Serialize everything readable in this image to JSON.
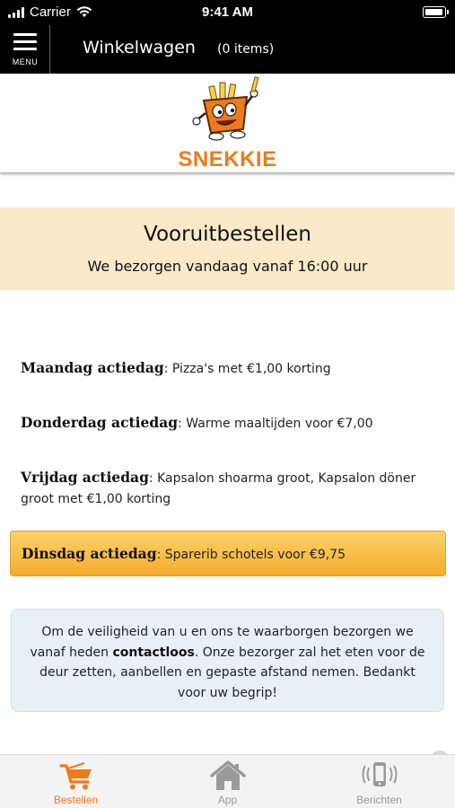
{
  "status_bar": {
    "carrier": "Carrier",
    "time": "9:41 AM",
    "wifi_icon": "wifi-icon",
    "battery_icon": "battery-icon",
    "signal_icon": "signal-icon"
  },
  "header": {
    "menu_label": "MENU",
    "title": "Winkelwagen",
    "item_count": "(0 items)"
  },
  "logo": {
    "brand_text": "SNEKKIE",
    "brand_color": "#f07a1a"
  },
  "banner": {
    "title": "Vooruitbestellen",
    "subtitle": "We bezorgen vandaag vanaf 16:00 uur",
    "background": "#fde9c9"
  },
  "promotions": [
    {
      "day": "Maandag actiedag",
      "text": ": Pizza's met €1,00 korting"
    },
    {
      "day": "Donderdag actiedag",
      "text": ": Warme maaltijden voor €7,00"
    },
    {
      "day": "Vrijdag actiedag",
      "text": ": Kapsalon shoarma groot, Kapsalon döner groot met €1,00 korting"
    }
  ],
  "highlight_promo": {
    "day": "Dinsdag actiedag",
    "text": ": Sparerib schotels voor €9,75"
  },
  "notice": {
    "part1": "Om de veiligheid van u en ons te waarborgen bezorgen we vanaf heden ",
    "bold": "contactloos",
    "part2": ". Onze bezorger zal het eten voor de deur zetten, aanbellen en gepaste afstand nemen. Bedankt voor uw begrip!"
  },
  "tabs": [
    {
      "label": "Bestellen",
      "icon": "cart-icon",
      "active": true,
      "color": "#f07a1a"
    },
    {
      "label": "App",
      "icon": "home-icon",
      "active": false,
      "color": "#9a9a9a"
    },
    {
      "label": "Berichten",
      "icon": "phone-vibrate-icon",
      "active": false,
      "color": "#9a9a9a"
    }
  ]
}
